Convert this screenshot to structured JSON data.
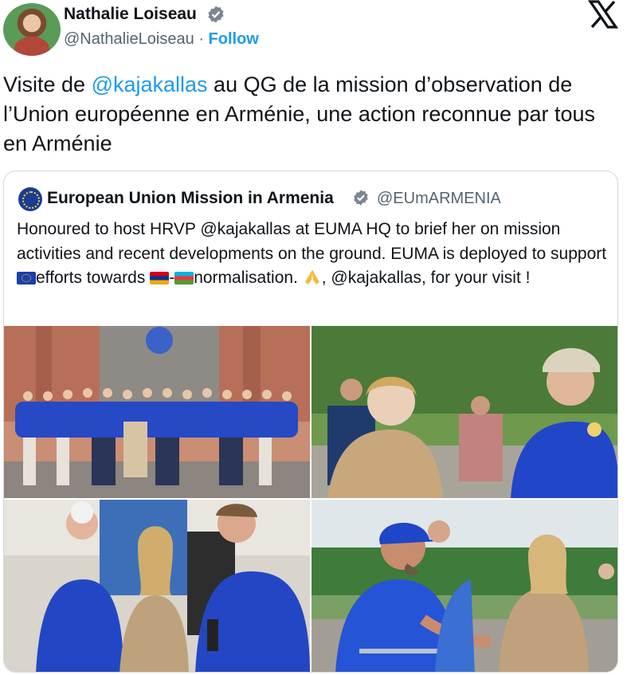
{
  "author": {
    "name": "Nathalie Loiseau",
    "handle": "@NathalieLoiseau",
    "separator": "·",
    "follow_label": "Follow"
  },
  "tweet": {
    "part1": "Visite de ",
    "mention": "@kajakallas",
    "part2": " au QG de la mission d’observation de l’Union européenne en Arménie, une action reconnue par tous en Arménie"
  },
  "quoted": {
    "name": "European Union Mission in Armenia",
    "handle": "@EUmARMENIA",
    "text_1": "Honoured to host HRVP @kajakallas at EUMA HQ to brief her on mission activities and recent developments on the ground. EUMA is deployed to support ",
    "text_2": "efforts towards ",
    "text_3": "-",
    "text_4": "normalisation. ",
    "text_5": ", @kajakallas, for your visit !"
  },
  "icons": {
    "verified": "verified-badge-icon",
    "x_logo": "x-logo-icon",
    "eu_flag": "eu-flag-icon",
    "armenia_flag": "armenia-flag-icon",
    "azerbaijan_flag": "azerbaijan-flag-icon",
    "pray": "folded-hands-icon"
  },
  "colors": {
    "link": "#1d9bf0",
    "text": "#0f1419",
    "secondary": "#536471",
    "euma_blue": "#1f45c8"
  }
}
